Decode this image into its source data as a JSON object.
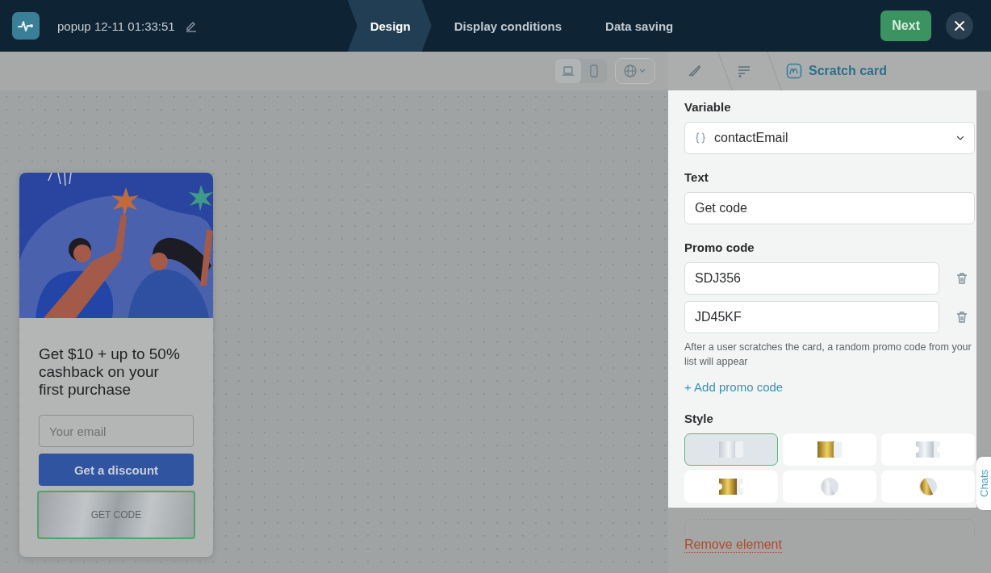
{
  "header": {
    "title": "popup 12-11 01:33:51",
    "steps": [
      {
        "label": "Design",
        "selected": true
      },
      {
        "label": "Display conditions",
        "selected": false
      },
      {
        "label": "Data saving",
        "selected": false
      }
    ],
    "next_button": "Next"
  },
  "canvas_toolbar": {
    "devices": [
      {
        "kind": "desktop",
        "selected": true
      },
      {
        "kind": "mobile",
        "selected": false
      }
    ]
  },
  "popup": {
    "heading": "Get $10 + up to 50% cashback on your first purchase",
    "email_placeholder": "Your email",
    "button": "Get a discount",
    "scratch_card": "GET CODE"
  },
  "panel": {
    "breadcrumb": "Scratch card",
    "variable_label": "Variable",
    "variable_value": "contactEmail",
    "text_label": "Text",
    "text_value": "Get code",
    "promo_label": "Promo code",
    "promo_codes": [
      "SDJ356",
      "JD45KF"
    ],
    "promo_hint": "After a user scratches the card, a random promo code from your list will appear",
    "add_promo": "+ Add promo code",
    "style_label": "Style",
    "styles": [
      {
        "kind": "silver-card",
        "selected": true
      },
      {
        "kind": "gold-card",
        "selected": false
      },
      {
        "kind": "silver-ticket",
        "selected": false
      },
      {
        "kind": "gold-ticket",
        "selected": false
      },
      {
        "kind": "silver-circle",
        "selected": false
      },
      {
        "kind": "gold-circle",
        "selected": false
      }
    ],
    "remove": "Remove element"
  },
  "chats_tab": "Chats"
}
